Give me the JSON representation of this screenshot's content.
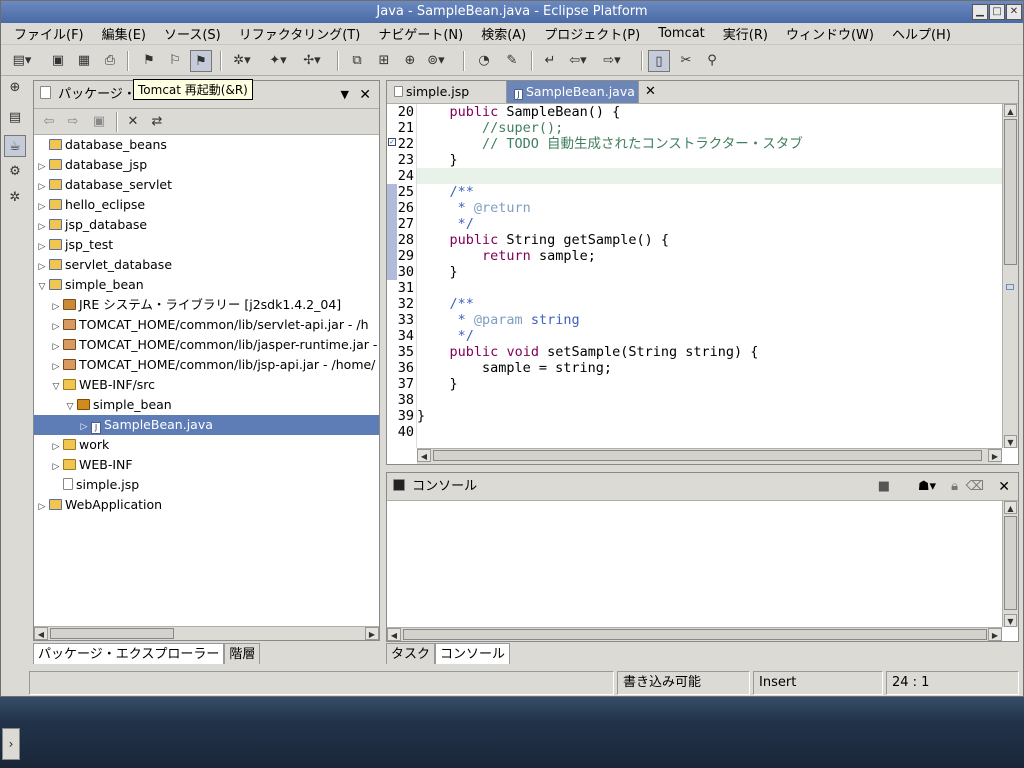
{
  "window": {
    "title": "Java - SampleBean.java - Eclipse Platform"
  },
  "menu": [
    "ファイル(F)",
    "編集(E)",
    "ソース(S)",
    "リファクタリング(T)",
    "ナビゲート(N)",
    "検索(A)",
    "プロジェクト(P)",
    "Tomcat",
    "実行(R)",
    "ウィンドウ(W)",
    "ヘルプ(H)"
  ],
  "tooltip": "Tomcat 再起動(&R)",
  "package_explorer": {
    "title": "パッケージ・",
    "tree": [
      {
        "label": "database_beans",
        "icon": "project-folder-icon",
        "depth": 0,
        "twisty": "none"
      },
      {
        "label": "database_jsp",
        "icon": "project-folder-icon",
        "depth": 0,
        "twisty": "collapsed"
      },
      {
        "label": "database_servlet",
        "icon": "project-folder-icon",
        "depth": 0,
        "twisty": "collapsed"
      },
      {
        "label": "hello_eclipse",
        "icon": "project-folder-icon",
        "depth": 0,
        "twisty": "collapsed"
      },
      {
        "label": "jsp_database",
        "icon": "project-folder-icon",
        "depth": 0,
        "twisty": "collapsed"
      },
      {
        "label": "jsp_test",
        "icon": "project-folder-icon",
        "depth": 0,
        "twisty": "collapsed"
      },
      {
        "label": "servlet_database",
        "icon": "project-folder-icon",
        "depth": 0,
        "twisty": "collapsed"
      },
      {
        "label": "simple_bean",
        "icon": "project-folder-icon",
        "depth": 0,
        "twisty": "expanded"
      },
      {
        "label": "JRE システム・ライブラリー [j2sdk1.4.2_04]",
        "icon": "library-icon",
        "depth": 1,
        "twisty": "collapsed"
      },
      {
        "label": "TOMCAT_HOME/common/lib/servlet-api.jar - /h",
        "icon": "jar-icon",
        "depth": 1,
        "twisty": "collapsed"
      },
      {
        "label": "TOMCAT_HOME/common/lib/jasper-runtime.jar -",
        "icon": "jar-icon",
        "depth": 1,
        "twisty": "collapsed"
      },
      {
        "label": "TOMCAT_HOME/common/lib/jsp-api.jar - /home/",
        "icon": "jar-icon",
        "depth": 1,
        "twisty": "collapsed"
      },
      {
        "label": "WEB-INF/src",
        "icon": "source-folder-icon",
        "depth": 1,
        "twisty": "expanded"
      },
      {
        "label": "simple_bean",
        "icon": "package-icon",
        "depth": 2,
        "twisty": "expanded"
      },
      {
        "label": "SampleBean.java",
        "icon": "java-file-icon",
        "depth": 3,
        "twisty": "collapsed",
        "selected": true
      },
      {
        "label": "work",
        "icon": "folder-icon",
        "depth": 1,
        "twisty": "collapsed"
      },
      {
        "label": "WEB-INF",
        "icon": "folder-icon",
        "depth": 1,
        "twisty": "collapsed"
      },
      {
        "label": "simple.jsp",
        "icon": "jsp-file-icon",
        "depth": 1,
        "twisty": "none"
      },
      {
        "label": "WebApplication",
        "icon": "project-folder-icon",
        "depth": 0,
        "twisty": "collapsed"
      }
    ],
    "bottom_tabs": [
      "パッケージ・エクスプローラー",
      "階層"
    ]
  },
  "editor": {
    "tabs": [
      {
        "label": "simple.jsp",
        "active": false
      },
      {
        "label": "SampleBean.java",
        "active": true
      }
    ],
    "lines": [
      {
        "n": "20",
        "html": "    <span class=\"kw\">public</span> SampleBean() {"
      },
      {
        "n": "21",
        "html": "        <span class=\"cm\">//super();</span>"
      },
      {
        "n": "22",
        "html": "        <span class=\"cm\">// TODO 自動生成されたコンストラクター・スタブ</span>"
      },
      {
        "n": "23",
        "html": "    }"
      },
      {
        "n": "24",
        "html": ""
      },
      {
        "n": "25",
        "html": "    <span class=\"jd\">/**</span>"
      },
      {
        "n": "26",
        "html": "     <span class=\"jd\">* </span><span class=\"jt\">@return</span>"
      },
      {
        "n": "27",
        "html": "     <span class=\"jd\">*/</span>"
      },
      {
        "n": "28",
        "html": "    <span class=\"kw\">public</span> String getSample() {"
      },
      {
        "n": "29",
        "html": "        <span class=\"kw\">return</span> sample;"
      },
      {
        "n": "30",
        "html": "    }"
      },
      {
        "n": "31",
        "html": ""
      },
      {
        "n": "32",
        "html": "    <span class=\"jd\">/**</span>"
      },
      {
        "n": "33",
        "html": "     <span class=\"jd\">* </span><span class=\"jt\">@param</span><span class=\"jd\"> string</span>"
      },
      {
        "n": "34",
        "html": "     <span class=\"jd\">*/</span>"
      },
      {
        "n": "35",
        "html": "    <span class=\"kw\">public</span> <span class=\"kw\">void</span> setSample(String string) {"
      },
      {
        "n": "36",
        "html": "        sample = string;"
      },
      {
        "n": "37",
        "html": "    }"
      },
      {
        "n": "38",
        "html": ""
      },
      {
        "n": "39",
        "html": "}"
      },
      {
        "n": "40",
        "html": ""
      }
    ],
    "current_line": "24"
  },
  "console": {
    "title": "コンソール",
    "bottom_tabs": [
      "タスク",
      "コンソール"
    ]
  },
  "status": {
    "writable": "書き込み可能",
    "mode": "Insert",
    "position": "24 : 1"
  }
}
